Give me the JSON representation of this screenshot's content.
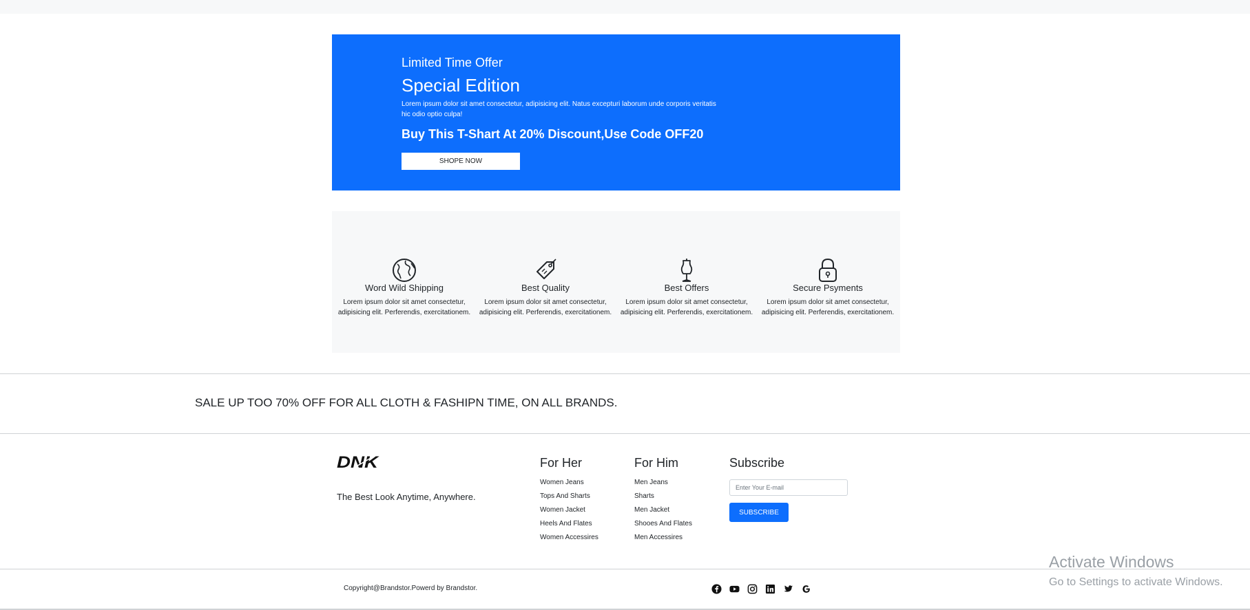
{
  "hero": {
    "kicker": "Limited Time Offer",
    "title": "Special Edition",
    "text": "Lorem ipsum dolor sit amet consectetur, adipisicing elit. Natus excepturi laborum unde corporis veritatis hic odio optio culpa!",
    "offer": "Buy This T-Shart At 20% Discount,Use Code OFF20",
    "button_label": "SHOPE NOW",
    "bg_color": "#0d6efd"
  },
  "features": [
    {
      "icon": "globe-icon",
      "title": "Word Wild Shipping",
      "text": "Lorem ipsum dolor sit amet consectetur, adipisicing elit. Perferendis, exercitationem."
    },
    {
      "icon": "price-tag-icon",
      "title": "Best Quality",
      "text": "Lorem ipsum dolor sit amet consectetur, adipisicing elit. Perferendis, exercitationem."
    },
    {
      "icon": "dress-form-icon",
      "title": "Best Offers",
      "text": "Lorem ipsum dolor sit amet consectetur, adipisicing elit. Perferendis, exercitationem."
    },
    {
      "icon": "padlock-icon",
      "title": "Secure Psyments",
      "text": "Lorem ipsum dolor sit amet consectetur, adipisicing elit. Perferendis, exercitationem."
    }
  ],
  "sale_text": "SALE UP TOO 70% OFF FOR ALL CLOTH & FASHIPN TIME, ON ALL BRANDS.",
  "footer": {
    "logo_text": "DNK",
    "tagline": "The Best Look Anytime, Anywhere.",
    "for_her": {
      "title": "For Her",
      "items": [
        "Women Jeans",
        "Tops And Sharts",
        "Women Jacket",
        "Heels And Flates",
        "Women Accessires"
      ]
    },
    "for_him": {
      "title": "For Him",
      "items": [
        "Men Jeans",
        "Sharts",
        "Men Jacket",
        "Shooes And Flates",
        "Men Accessires"
      ]
    },
    "subscribe": {
      "title": "Subscribe",
      "placeholder": "Enter Your E-mail",
      "button_label": "SUBSCRIBE"
    },
    "copyright": "Copyright@Brandstor.Powerd by Brandstor.",
    "socials": [
      "facebook-icon",
      "youtube-icon",
      "instagram-icon",
      "linkedin-icon",
      "twitter-icon",
      "google-icon"
    ]
  },
  "watermark": {
    "line1": "Activate Windows",
    "line2": "Go to Settings to activate Windows."
  }
}
